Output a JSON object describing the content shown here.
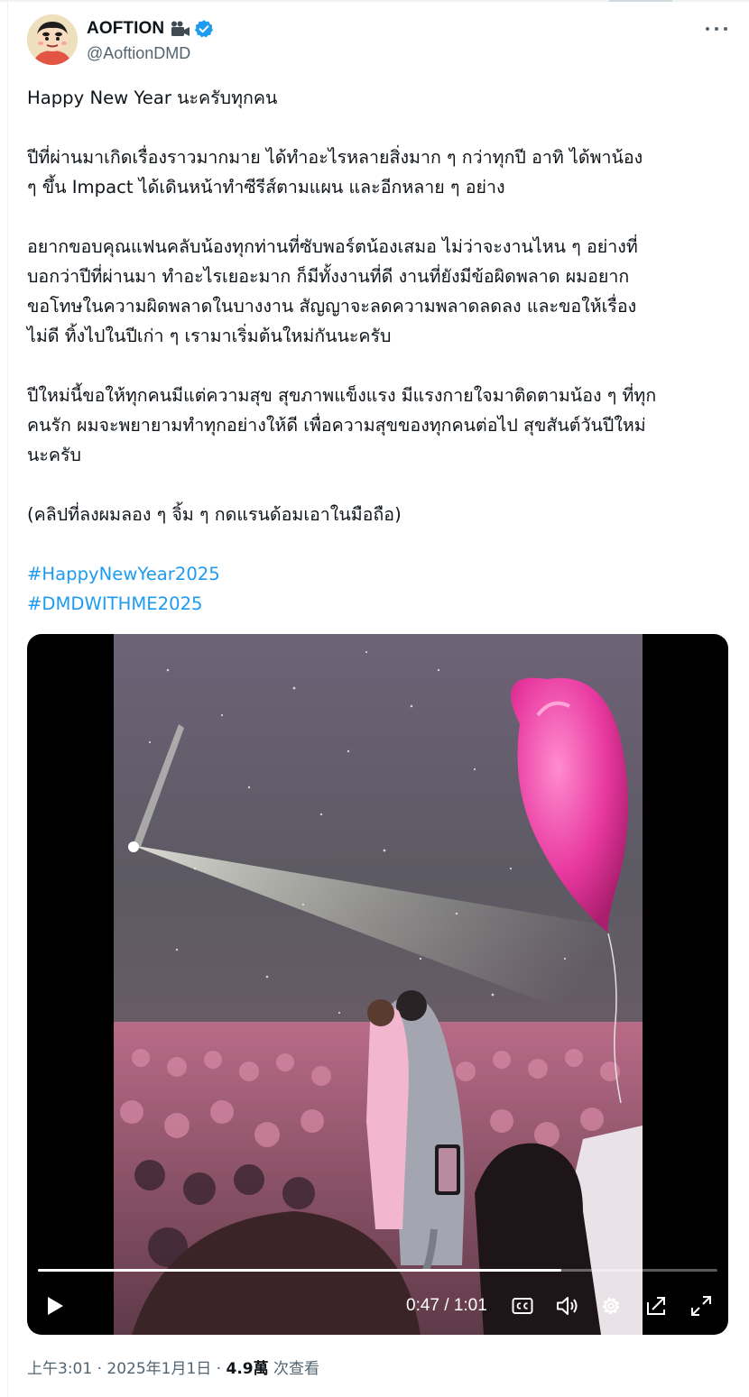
{
  "author": {
    "display_name": "AOFTION",
    "handle": "@AoftionDMD"
  },
  "tweet": {
    "paragraphs": [
      "Happy New Year นะครับทุกคน",
      "ปีที่ผ่านมาเกิดเรื่องราวมากมาย ได้ทำอะไรหลายสิ่งมาก ๆ กว่าทุกปี อาทิ ได้พาน้อง\n ๆ ขึ้น Impact ได้เดินหน้าทำซีรีส์ตามแผน และอีกหลาย ๆ อย่าง",
      "อยากขอบคุณแฟนคลับน้องทุกท่านที่ซับพอร์ตน้องเสมอ ไม่ว่าจะงานไหน ๆ อย่างที่\nบอกว่าปีที่ผ่านมา ทำอะไรเยอะมาก ก็มีทั้งงานที่ดี งานที่ยังมีข้อผิดพลาด ผมอยาก\nขอโทษในความผิดพลาดในบางงาน สัญญาจะลดความพลาดลดลง และขอให้เรื่อง\nไม่ดี ทิ้งไปในปีเก่า ๆ เรามาเริ่มต้นใหม่กันนะครับ",
      "ปีใหม่นี้ขอให้ทุกคนมีแต่ความสุข สุขภาพแข็งแรง มีแรงกายใจมาติดตามน้อง ๆ ที่ทุก\nคนรัก ผมจะพยายามทำทุกอย่างให้ดี เพื่อความสุขของทุกคนต่อไป สุขสันต์วันปีใหม่\nนะครับ",
      "(คลิปที่ลงผมลอง ๆ จิ้ม ๆ กดแรนด้อมเอาในมือถือ)"
    ],
    "hashtags": [
      "#HappyNewYear2025",
      "#DMDWITHME2025"
    ]
  },
  "video": {
    "time_display": "0:47 / 1:01",
    "progress": 0.77
  },
  "meta": {
    "timestamp": "上午3:01 · 2025年1月1日 · ",
    "views_count": "4.9萬",
    "views_label": " 次查看"
  },
  "colors": {
    "link": "#1d9bf0",
    "verified": "#1d9bf0",
    "text": "#0f1419",
    "secondary": "#536471"
  },
  "icons": [
    "camera-icon",
    "verified-icon",
    "more-icon",
    "play-icon",
    "captions-icon",
    "volume-icon",
    "settings-icon",
    "pip-icon",
    "fullscreen-icon"
  ]
}
